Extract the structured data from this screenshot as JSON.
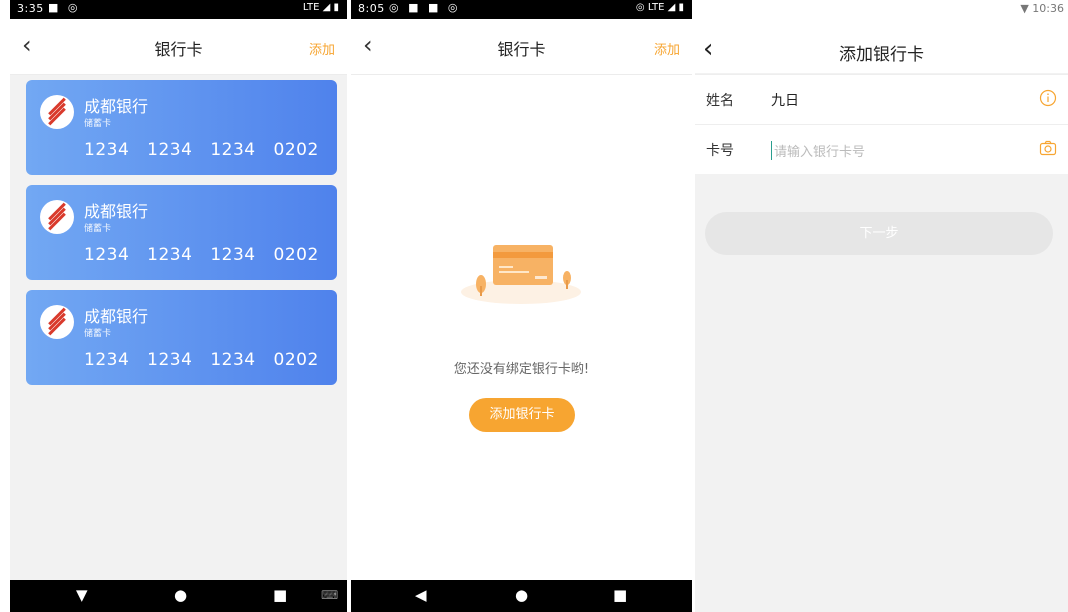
{
  "screens": [
    {
      "status": {
        "time": "3:35",
        "icons": "■ ◎",
        "right": "LTE ◢ ▮"
      },
      "nav": {
        "back": "‹",
        "title": "银行卡",
        "action": "添加"
      },
      "cards": [
        {
          "bank": "成都银行",
          "type": "储蓄卡",
          "number": "1234 1234 1234 0202"
        },
        {
          "bank": "成都银行",
          "type": "储蓄卡",
          "number": "1234 1234 1234 0202"
        },
        {
          "bank": "成都银行",
          "type": "储蓄卡",
          "number": "1234 1234 1234 0202"
        }
      ],
      "sysnav": [
        "▼",
        "●",
        "■",
        "⌨"
      ]
    },
    {
      "status": {
        "time": "8:05",
        "icons": "◎ ■ ■ ◎",
        "right": "◎ LTE ◢ ▮"
      },
      "nav": {
        "back": "‹",
        "title": "银行卡",
        "action": "添加"
      },
      "empty_text": "您还没有绑定银行卡哟!",
      "add_button": "添加银行卡",
      "sysnav": [
        "◀",
        "●",
        "■"
      ]
    },
    {
      "status": {
        "time": "▼ 10:36"
      },
      "nav": {
        "back": "‹",
        "title": "添加银行卡"
      },
      "fields": [
        {
          "label": "姓名",
          "value": "九日",
          "icon": "info-icon"
        },
        {
          "label": "卡号",
          "placeholder": "请输入银行卡号",
          "icon": "camera-icon"
        }
      ],
      "next_button": "下一步"
    }
  ],
  "colors": {
    "accent": "#f7a531",
    "card_start": "#72a8f3",
    "card_end": "#4f82ec",
    "bank_logo": "#d93a2c"
  }
}
